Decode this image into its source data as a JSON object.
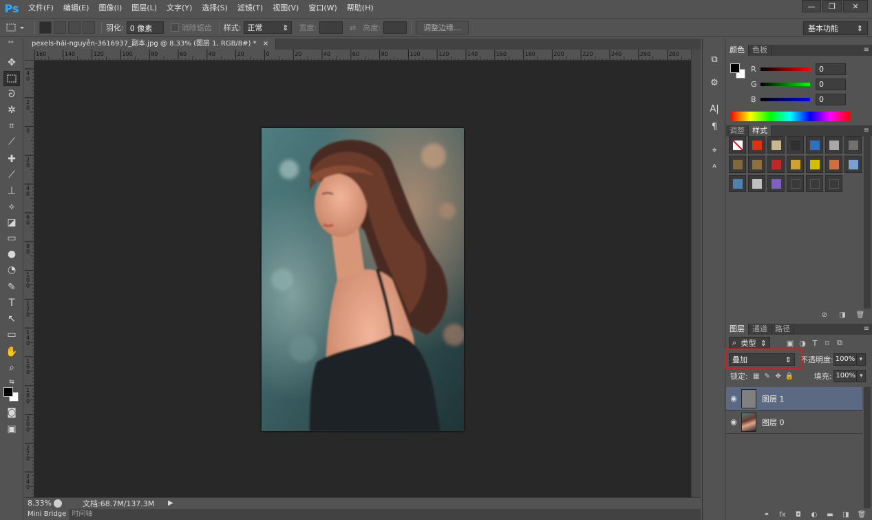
{
  "app": {
    "logo": "Ps"
  },
  "menu": [
    "文件(F)",
    "编辑(E)",
    "图像(I)",
    "图层(L)",
    "文字(Y)",
    "选择(S)",
    "滤镜(T)",
    "视图(V)",
    "窗口(W)",
    "帮助(H)"
  ],
  "window_controls": {
    "minimize": "—",
    "restore": "❐",
    "close": "✕"
  },
  "options": {
    "feather_label": "羽化:",
    "feather_value": "0 像素",
    "antialias_label": "消除锯齿",
    "style_label": "样式:",
    "style_value": "正常",
    "width_label": "宽度:",
    "height_label": "高度:",
    "refine_edge_button": "调整边缘...",
    "workspace": "基本功能"
  },
  "document": {
    "tab_title": "pexels-hải-nguyễn-3616937_副本.jpg @ 8.33% (图层 1, RGB/8#) *",
    "tab_close": "×",
    "ruler_h_labels": [
      "160",
      "140",
      "120",
      "100",
      "80",
      "60",
      "40",
      "20",
      "0",
      "20",
      "40",
      "60",
      "80",
      "100",
      "120",
      "140",
      "160",
      "180",
      "200",
      "220",
      "240",
      "260",
      "280"
    ],
    "ruler_v_labels": [
      "4\n0",
      "2\n0",
      "0",
      "2\n0",
      "4\n0",
      "6\n0",
      "8\n0",
      "1\n0\n0",
      "1\n2\n0",
      "1\n4\n0",
      "1\n6\n0",
      "1\n8\n0",
      "2\n0\n0",
      "2\n2\n0",
      "2\n4\n0"
    ]
  },
  "status": {
    "zoom": "8.33%",
    "doc_info": "文档:68.7M/137.3M",
    "arrow": "▶"
  },
  "bottom_tabs": [
    "Mini Bridge",
    "时间轴"
  ],
  "color_panel": {
    "tabs": [
      "颜色",
      "色板"
    ],
    "channels": [
      {
        "label": "R",
        "value": "0",
        "gradient": "linear-gradient(to right,#000,#ff0000)"
      },
      {
        "label": "G",
        "value": "0",
        "gradient": "linear-gradient(to right,#000,#00ff00)"
      },
      {
        "label": "B",
        "value": "0",
        "gradient": "linear-gradient(to right,#000,#0000ff)"
      }
    ],
    "foreground": "#000000",
    "background": "#ffffff"
  },
  "styles_panel": {
    "tabs": [
      "调整",
      "样式"
    ],
    "swatches": [
      "none",
      "#e03010",
      "#c8b890",
      "#303030",
      "#3070c0",
      "#a8a8a8",
      "#707070",
      "#806838",
      "#90703c",
      "#c02828",
      "#d0a030",
      "#d0c000",
      "#d07040",
      "#7aa0d0",
      "#5080b0",
      "#c0c0c0",
      "#8060c0",
      "#444444",
      "#444444",
      "#444444"
    ]
  },
  "layers_panel": {
    "tabs": [
      "图层",
      "通道",
      "路径"
    ],
    "kind_label": "类型",
    "blend_mode": "叠加",
    "opacity_label": "不透明度:",
    "opacity_value": "100%",
    "lock_label": "锁定:",
    "fill_label": "填充:",
    "fill_value": "100%",
    "layers": [
      {
        "name": "图层 1",
        "selected": true,
        "thumb": "#808080"
      },
      {
        "name": "图层 0",
        "selected": false,
        "thumb": "photo"
      }
    ]
  },
  "accent_colors": {
    "selection": "#5b6a82",
    "highlight_box": "#d02020",
    "ps_blue": "#31a8ff"
  }
}
